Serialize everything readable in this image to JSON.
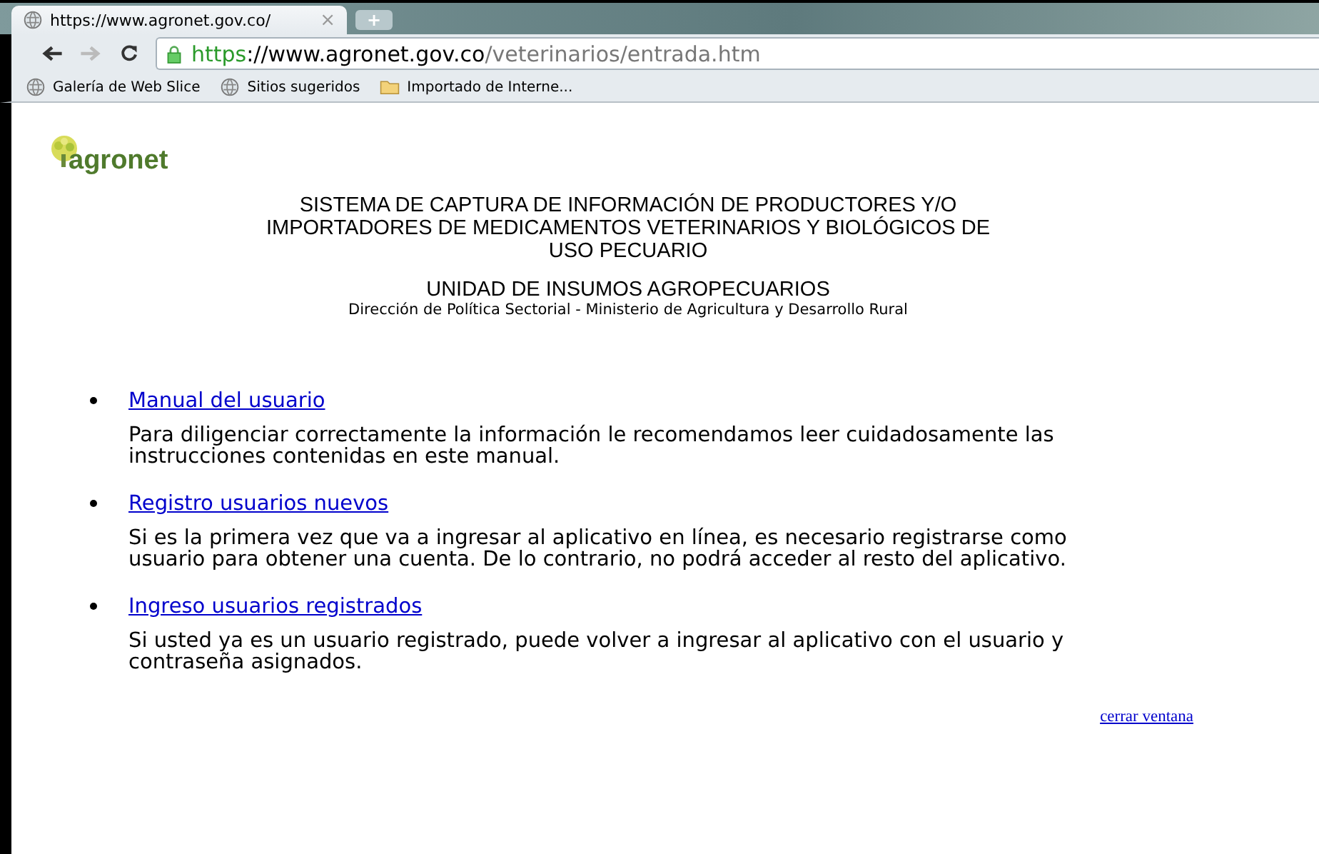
{
  "browser": {
    "tab": {
      "title": "https://www.agronet.gov.co/",
      "close": "×",
      "new_tab": "+"
    },
    "address": {
      "scheme": "https",
      "host": "://www.agronet.gov.co",
      "path": "/veterinarios/entrada.htm"
    },
    "bookmarks": [
      {
        "label": "Galería de Web Slice",
        "kind": "globe"
      },
      {
        "label": "Sitios sugeridos",
        "kind": "globe"
      },
      {
        "label": "Importado de Interne...",
        "kind": "folder"
      }
    ]
  },
  "page": {
    "logo": "agronet",
    "title_lines": [
      "SISTEMA DE CAPTURA DE INFORMACIÓN DE PRODUCTORES Y/O",
      "IMPORTADORES DE MEDICAMENTOS VETERINARIOS Y BIOLÓGICOS DE",
      "USO PECUARIO"
    ],
    "unit": "UNIDAD DE INSUMOS AGROPECUARIOS",
    "subtitle": "Dirección de Política Sectorial - Ministerio de Agricultura y Desarrollo Rural",
    "items": [
      {
        "link": "Manual del usuario ",
        "text": "Para diligenciar correctamente la información le recomendamos leer cuidadosamente las instrucciones contenidas en este manual."
      },
      {
        "link": "Registro usuarios nuevos",
        "text": "Si es la primera vez que va a ingresar al aplicativo en línea, es necesario registrarse como usuario para obtener una cuenta. De lo contrario, no podrá acceder al resto del aplicativo."
      },
      {
        "link": "Ingreso usuarios registrados",
        "text": "Si usted ya es un usuario registrado, puede volver a ingresar al aplicativo con el usuario y contraseña asignados."
      }
    ],
    "close_link": "cerrar ventana"
  }
}
